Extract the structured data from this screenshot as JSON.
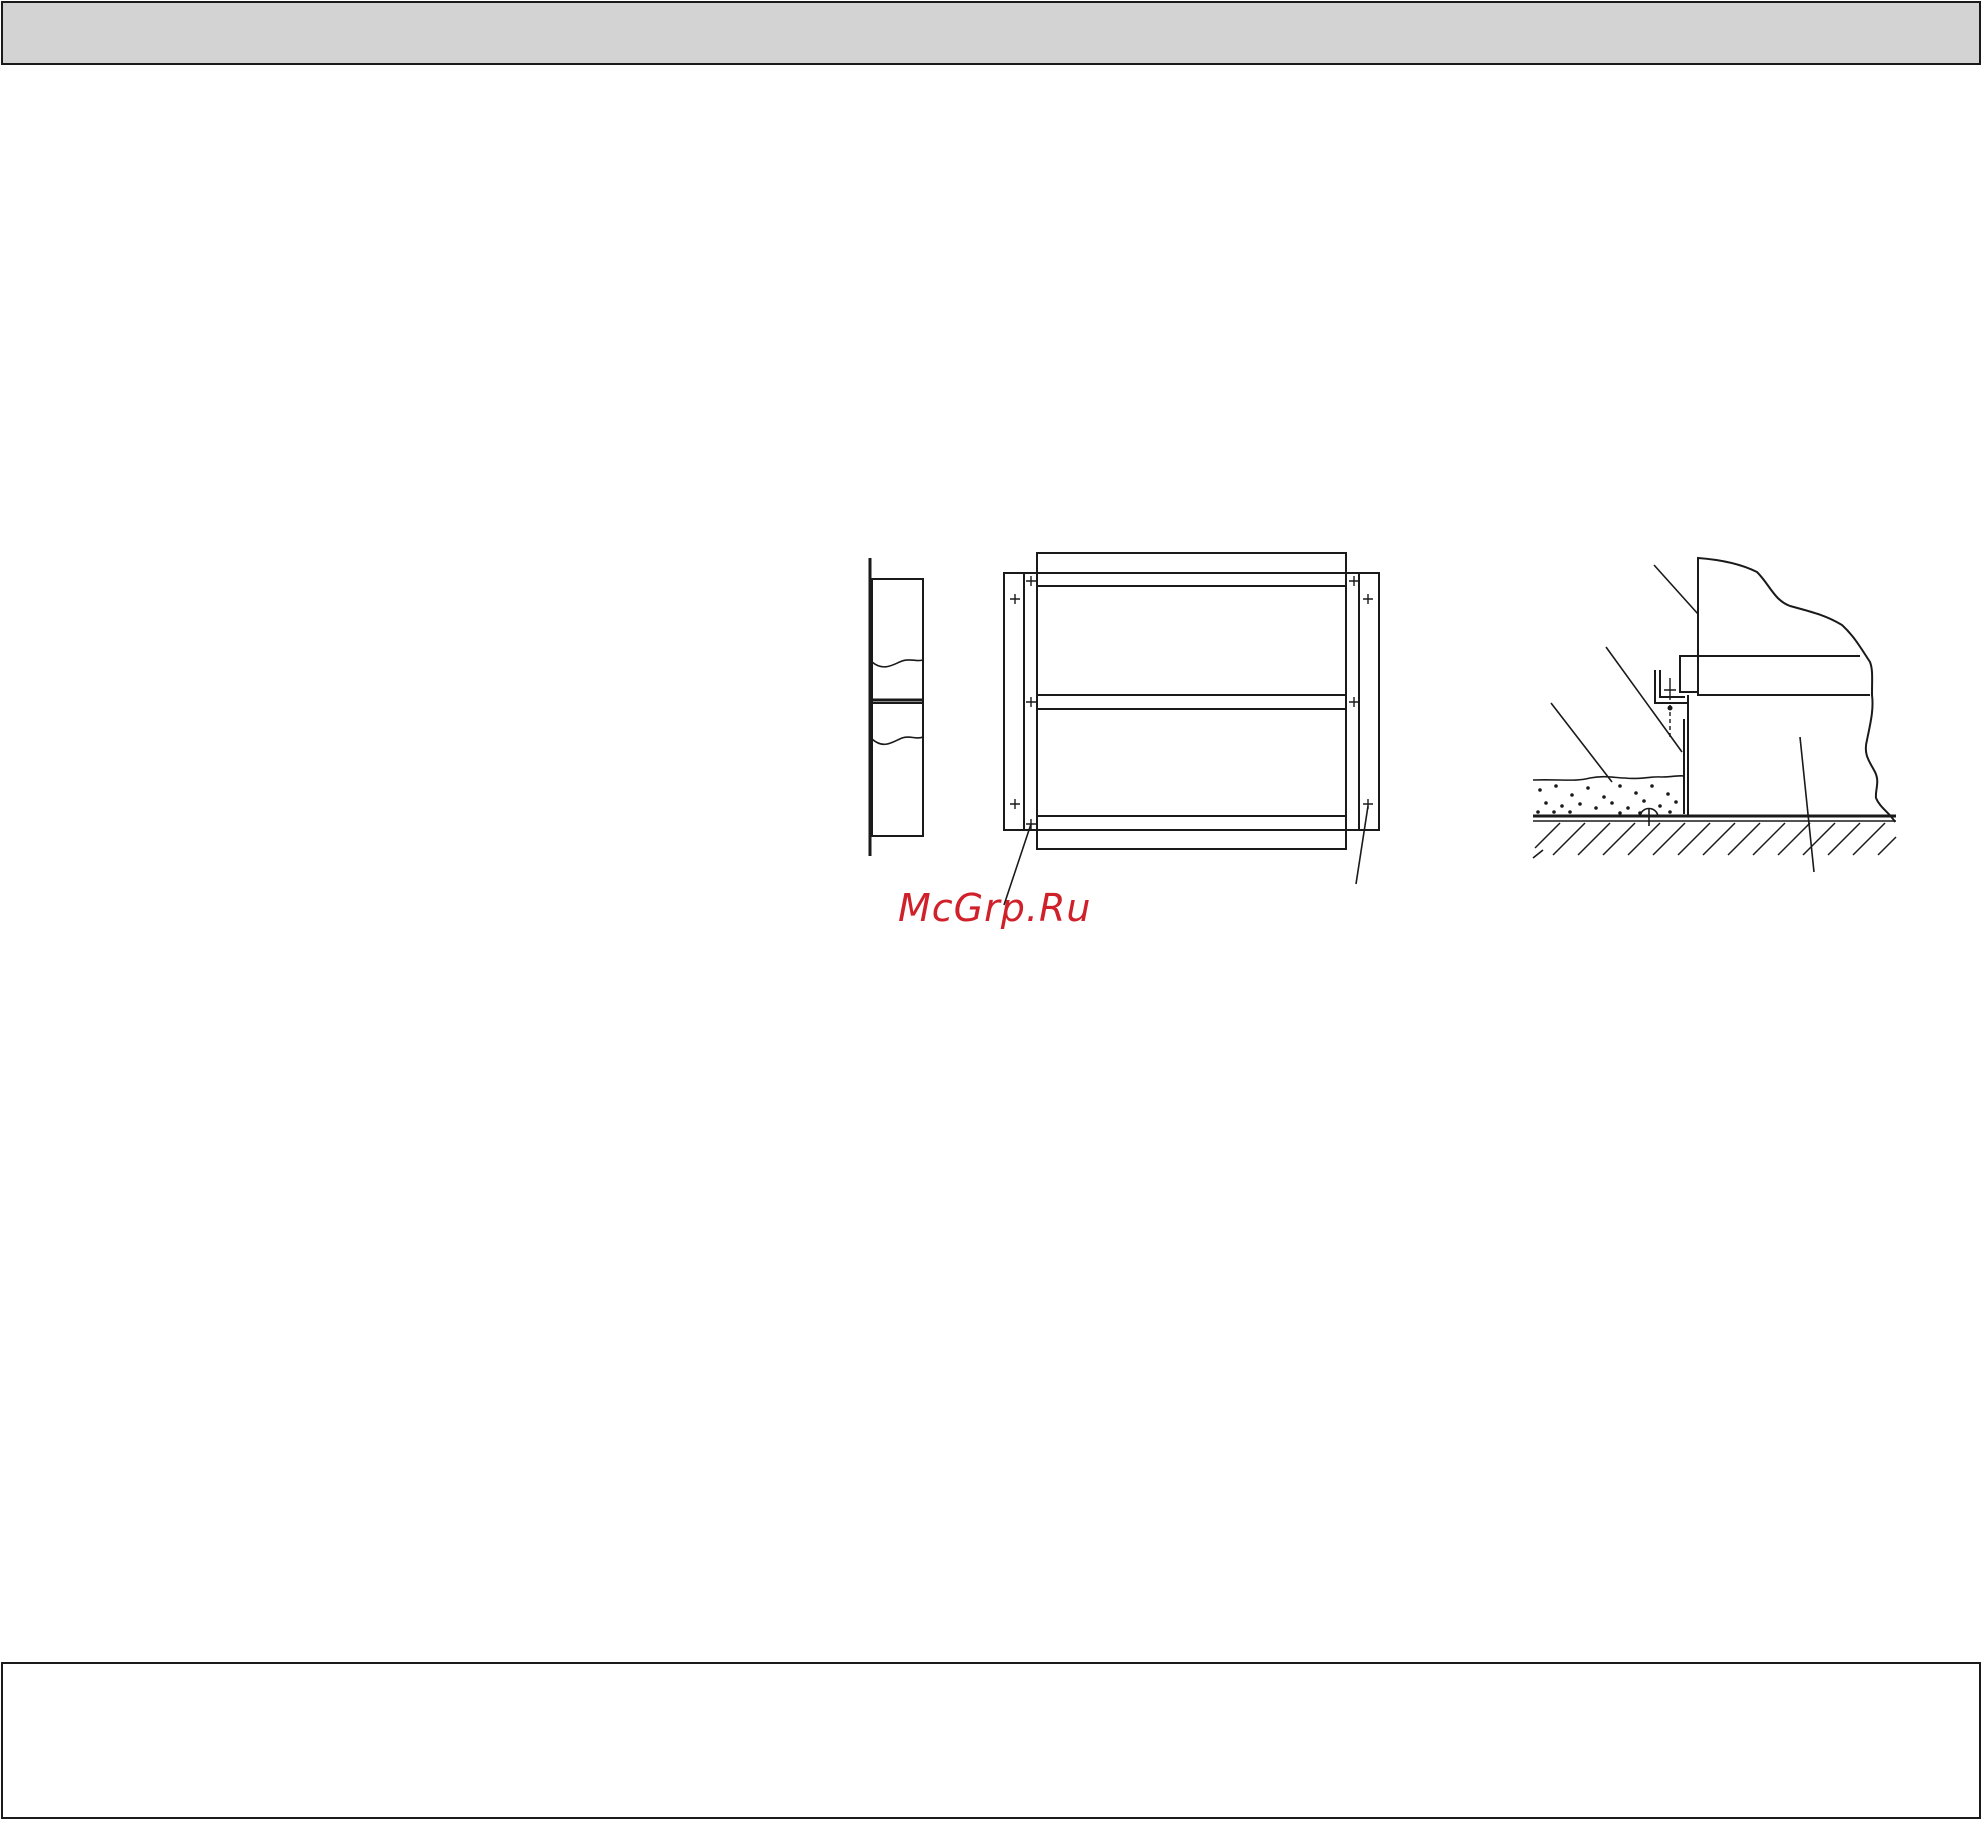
{
  "page": {
    "background": "#ffffff",
    "header_bar_color": "#d3d3d3",
    "line_color": "#1a1a1a"
  },
  "watermark": {
    "text": "McGrp.Ru",
    "color": "#d0202a"
  }
}
